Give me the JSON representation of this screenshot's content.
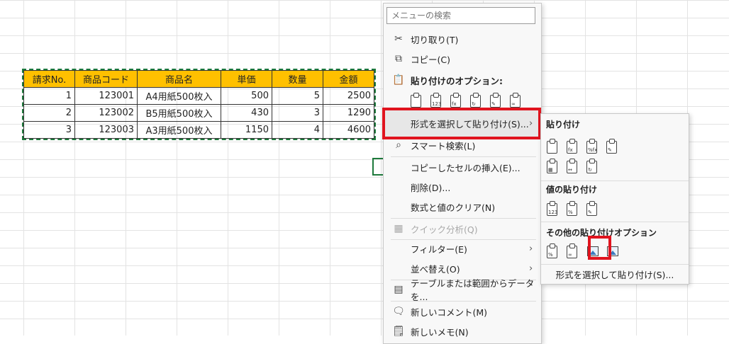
{
  "table": {
    "headers": [
      "請求No.",
      "商品コード",
      "商品名",
      "単価",
      "数量",
      "金額"
    ],
    "rows": [
      [
        "1",
        "123001",
        "A4用紙500枚入",
        "500",
        "5",
        "2500"
      ],
      [
        "2",
        "123002",
        "B5用紙500枚入",
        "430",
        "3",
        "1290"
      ],
      [
        "3",
        "123003",
        "A3用紙500枚入",
        "1150",
        "4",
        "4600"
      ]
    ]
  },
  "menu": {
    "search_placeholder": "メニューの検索",
    "cut": "切り取り(T)",
    "copy": "コピー(C)",
    "paste_options": "貼り付けのオプション:",
    "paste_special": "形式を選択して貼り付け(S)...",
    "smart_lookup": "スマート検索(L)",
    "insert_copied": "コピーしたセルの挿入(E)...",
    "delete": "削除(D)...",
    "clear": "数式と値のクリア(N)",
    "quick_analysis": "クイック分析(Q)",
    "filter": "フィルター(E)",
    "sort": "並べ替え(O)",
    "from_table": "テーブルまたは範囲からデータを...",
    "new_comment": "新しいコメント(M)",
    "new_note": "新しいメモ(N)"
  },
  "submenu": {
    "paste_header": "貼り付け",
    "values_header": "値の貼り付け",
    "other_header": "その他の貼り付けオプション",
    "paste_special": "形式を選択して貼り付け(S)..."
  },
  "icons": {
    "cut": "scissors-icon",
    "copy": "copy-icon",
    "paste": "clipboard-icon",
    "smart_lookup": "lookup-icon",
    "table": "table-icon",
    "comment": "comment-icon",
    "note": "note-icon"
  },
  "colors": {
    "header_fill": "#ffc000",
    "highlight_box": "#e0141e",
    "selection": "#1e7a3c"
  }
}
